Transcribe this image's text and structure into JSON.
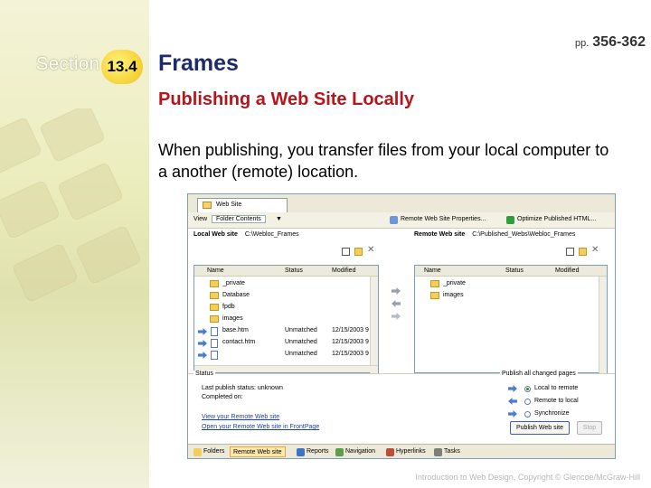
{
  "slide": {
    "section_label": "Section",
    "section_number": "13.4",
    "title": "Frames",
    "pages_prefix": "pp.",
    "pages": "356-362",
    "subtitle": "Publishing a Web Site Locally",
    "body": "When publishing, you transfer files from your local computer to a another (remote) location.",
    "footer": "Introduction to Web Design, Copyright © Glencoe/McGraw-Hill"
  },
  "app": {
    "tab_title": "Web Site",
    "toolbar": {
      "view_label": "View",
      "view_value": "Folder Contents",
      "remote_props": "Remote Web Site Properties...",
      "optimize": "Optimize Published HTML..."
    },
    "local": {
      "label": "Local Web site",
      "path": "C:\\Webloc_Frames",
      "columns": [
        "Name",
        "Status",
        "Modified"
      ],
      "rows": [
        {
          "name": "_private",
          "status": "",
          "modified": "",
          "type": "folder"
        },
        {
          "name": "Database",
          "status": "",
          "modified": "",
          "type": "folder"
        },
        {
          "name": "fpdb",
          "status": "",
          "modified": "",
          "type": "folder"
        },
        {
          "name": "images",
          "status": "",
          "modified": "",
          "type": "folder"
        },
        {
          "name": "base.htm",
          "status": "Unmatched",
          "modified": "12/15/2003 9",
          "type": "file"
        },
        {
          "name": "contact.htm",
          "status": "Unmatched",
          "modified": "12/15/2003 9",
          "type": "file"
        },
        {
          "name": "",
          "status": "Unmatched",
          "modified": "12/15/2003 9",
          "type": "file"
        }
      ]
    },
    "remote": {
      "label": "Remote Web site",
      "path": "C:\\Published_Webs\\Webloc_Frames",
      "columns": [
        "Name",
        "Status",
        "Modified"
      ],
      "rows": [
        {
          "name": "_private",
          "type": "folder"
        },
        {
          "name": "images",
          "type": "folder"
        }
      ]
    },
    "status": {
      "heading": "Status",
      "line1": "Last publish status: unknown",
      "line2": "Completed on:",
      "link1": "View your Remote Web site",
      "link2": "Open your Remote Web site in FrontPage"
    },
    "publish": {
      "heading": "Publish all changed pages",
      "options": [
        "Local to remote",
        "Remote to local",
        "Synchronize"
      ],
      "selected": 0,
      "publish_button": "Publish Web site",
      "close_button": "Stop"
    },
    "views": [
      "Folders",
      "Remote Web site",
      "Reports",
      "Navigation",
      "Hyperlinks",
      "Tasks"
    ],
    "active_view": 1
  }
}
